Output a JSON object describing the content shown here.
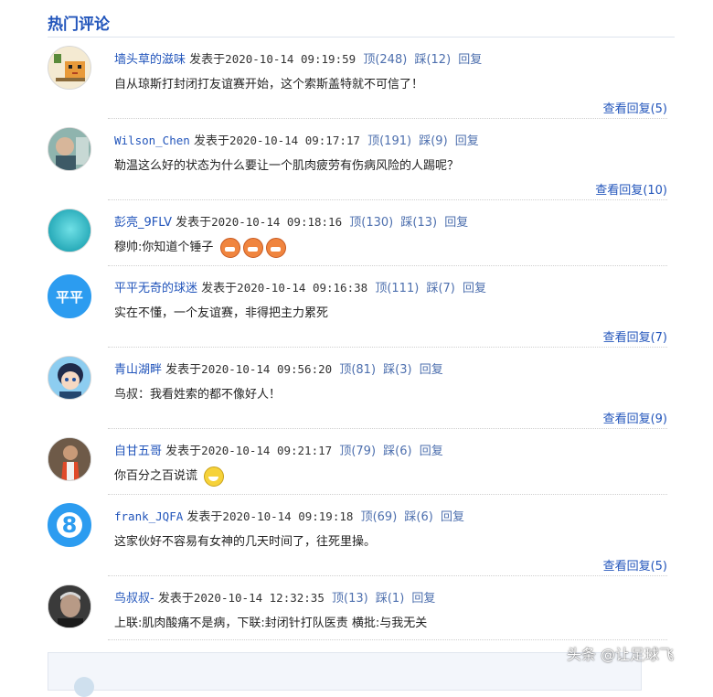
{
  "section": {
    "title": "热门评论"
  },
  "labels": {
    "posted": "发表于",
    "up": "顶",
    "down": "踩",
    "reply": "回复",
    "view_replies": "查看回复"
  },
  "comments": [
    {
      "user": "墙头草的滋味",
      "time": "2020-10-14 09:19:59",
      "up": "(248)",
      "down": "(12)",
      "text": "自从琼斯打封闭打友谊赛开始，这个索斯盖特就不可信了！",
      "view_count": "(5)"
    },
    {
      "user": "Wilson_Chen",
      "time": "2020-10-14 09:17:17",
      "up": "(191)",
      "down": "(9)",
      "text": "勒温这么好的状态为什么要让一个肌肉疲劳有伤病风险的人踢呢？",
      "view_count": "(10)"
    },
    {
      "user": "彭亮_9FLV",
      "time": "2020-10-14 09:18:16",
      "up": "(130)",
      "down": "(13)",
      "text": "穆帅:你知道个锤子",
      "view_count": ""
    },
    {
      "user": "平平无奇的球迷",
      "time": "2020-10-14 09:16:38",
      "up": "(111)",
      "down": "(7)",
      "text": "实在不懂，一个友谊赛，非得把主力累死",
      "view_count": "(7)",
      "avatar_text": "平平"
    },
    {
      "user": "青山湖畔",
      "time": "2020-10-14 09:56:20",
      "up": "(81)",
      "down": "(3)",
      "text": "鸟叔：我看姓索的都不像好人！",
      "view_count": "(9)"
    },
    {
      "user": "自甘五哥",
      "time": "2020-10-14 09:21:17",
      "up": "(79)",
      "down": "(6)",
      "text": "你百分之百说谎",
      "view_count": ""
    },
    {
      "user": "frank_JQFA",
      "time": "2020-10-14 09:19:18",
      "up": "(69)",
      "down": "(6)",
      "text": "这家伙好不容易有女神的几天时间了，往死里操。",
      "view_count": "(5)",
      "avatar_text": "8"
    },
    {
      "user": "鸟叔叔-",
      "time": "2020-10-14 12:32:35",
      "up": "(13)",
      "down": "(1)",
      "text": "上联:肌肉酸痛不是病，下联:封闭针打队医责 横批:与我无关",
      "view_count": ""
    }
  ],
  "watermark": "头条 @让足球飞",
  "colors": {
    "link": "#2255bb",
    "action": "#4d6fae",
    "accent_avatar": "#2c9cf0"
  }
}
